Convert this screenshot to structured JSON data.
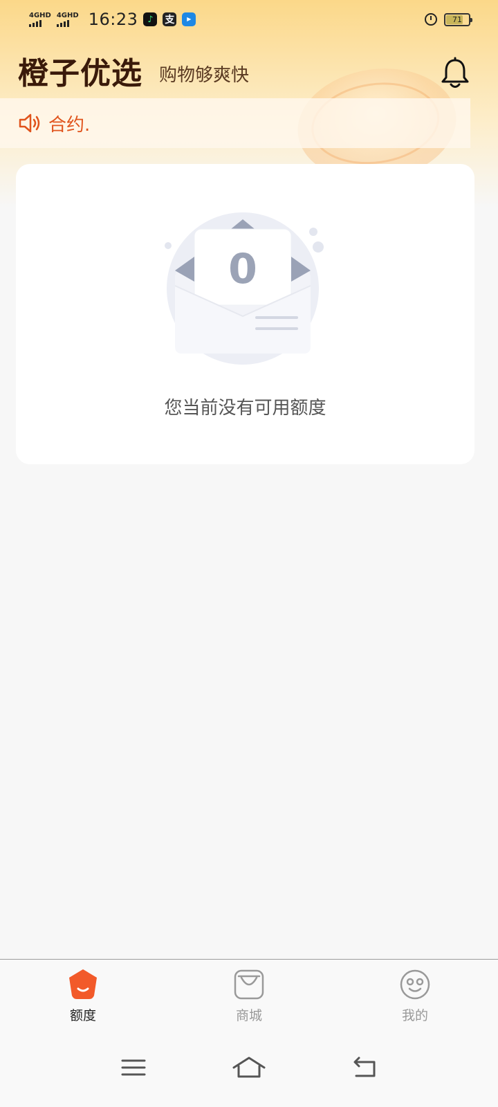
{
  "status_bar": {
    "network_1": "4GHD",
    "network_2": "4GHD",
    "time": "16:23",
    "battery": "71",
    "app_icons": [
      "music-app-icon",
      "alipay-icon",
      "live-tv-icon"
    ]
  },
  "header": {
    "title": "橙子优选",
    "subtitle": "购物够爽快",
    "bell_icon": "bell-icon"
  },
  "notice": {
    "text": "合约."
  },
  "empty_state": {
    "badge_value": "0",
    "message": "您当前没有可用额度"
  },
  "bottom_nav": {
    "items": [
      {
        "label": "额度",
        "icon": "quota-icon",
        "active": true
      },
      {
        "label": "商城",
        "icon": "shopping-bag-icon",
        "active": false
      },
      {
        "label": "我的",
        "icon": "smiley-icon",
        "active": false
      }
    ]
  },
  "colors": {
    "accent": "#e0531c",
    "title": "#3a1a0a",
    "active_icon": "#f25a2a"
  }
}
